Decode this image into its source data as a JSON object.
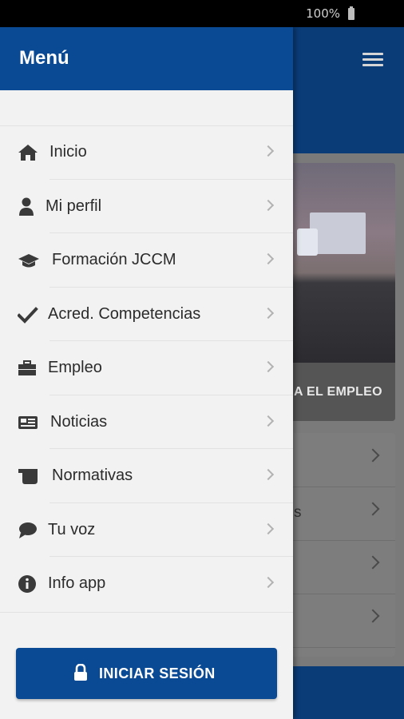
{
  "status_bar": {
    "battery": "100%"
  },
  "background_app": {
    "card_label_fragment": "A EL EMPLEO",
    "list_fragment": "s"
  },
  "drawer": {
    "title": "Menú",
    "items": [
      {
        "label": "Inicio",
        "icon": "home-icon"
      },
      {
        "label": "Mi perfil",
        "icon": "user-icon"
      },
      {
        "label": "Formación JCCM",
        "icon": "graduation-cap-icon"
      },
      {
        "label": "Acred. Competencias",
        "icon": "check-icon"
      },
      {
        "label": "Empleo",
        "icon": "briefcase-icon"
      },
      {
        "label": "Noticias",
        "icon": "newspaper-icon"
      },
      {
        "label": "Normativas",
        "icon": "scroll-icon"
      },
      {
        "label": "Tu voz",
        "icon": "chat-bubble-icon"
      },
      {
        "label": "Info app",
        "icon": "info-icon"
      }
    ],
    "login_button": "INICIAR SESIÓN"
  },
  "colors": {
    "brand_blue": "#0a4a94",
    "drawer_bg": "#f2f2f2"
  }
}
